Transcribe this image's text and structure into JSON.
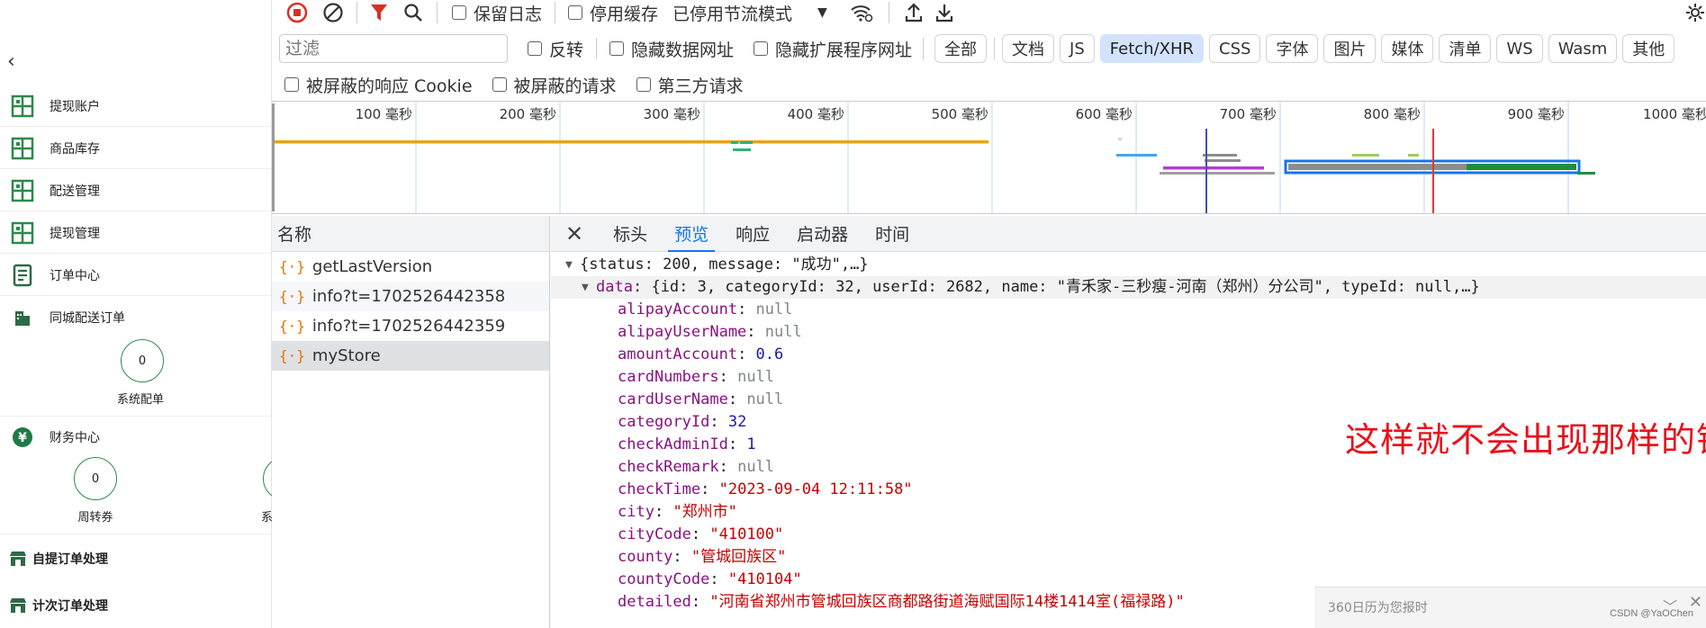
{
  "sidebar": {
    "back_icon": "chevron-left-icon",
    "nav_items": [
      {
        "label": "提现账户",
        "icon": "grid-icon"
      },
      {
        "label": "商品库存",
        "icon": "grid-icon"
      },
      {
        "label": "配送管理",
        "icon": "grid-icon"
      },
      {
        "label": "提现管理",
        "icon": "grid-icon"
      },
      {
        "label": "订单中心",
        "icon": "document-icon"
      },
      {
        "label": "同城配送订单",
        "icon": "building-icon"
      }
    ],
    "dispatch_circle": {
      "value": "0",
      "label": "系统配单"
    },
    "finance": {
      "label": "财务中心",
      "icon": "yen-icon"
    },
    "finance_circles": [
      {
        "value": "0",
        "label": "周转券"
      },
      {
        "value": "",
        "label": "系"
      }
    ],
    "sections": [
      {
        "label": "自提订单处理",
        "icon": "shop-icon"
      },
      {
        "label": "计次订单处理",
        "icon": "shop-icon"
      }
    ]
  },
  "devtools": {
    "toolbar": {
      "preserve_log": "保留日志",
      "disable_cache": "停用缓存",
      "throttling": "已停用节流模式"
    },
    "filter": {
      "placeholder": "过滤",
      "invert": "反转",
      "hide_data_urls": "隐藏数据网址",
      "hide_extension_urls": "隐藏扩展程序网址",
      "types": [
        "全部",
        "文档",
        "JS",
        "Fetch/XHR",
        "CSS",
        "字体",
        "图片",
        "媒体",
        "清单",
        "WS",
        "Wasm",
        "其他"
      ],
      "active_type": "Fetch/XHR",
      "blocked_cookies": "被屏蔽的响应 Cookie",
      "blocked_requests": "被屏蔽的请求",
      "third_party": "第三方请求"
    },
    "timeline": {
      "ticks": [
        "100 毫秒",
        "200 毫秒",
        "300 毫秒",
        "400 毫秒",
        "500 毫秒",
        "600 毫秒",
        "700 毫秒",
        "800 毫秒",
        "900 毫秒",
        "1000 毫秒"
      ]
    },
    "requests": {
      "header": "名称",
      "items": [
        "getLastVersion",
        "info?t=1702526442358",
        "info?t=1702526442359",
        "myStore"
      ],
      "selected": "myStore"
    },
    "preview_tabs": [
      "标头",
      "预览",
      "响应",
      "启动器",
      "时间"
    ],
    "active_tab": "预览",
    "json": {
      "root_summary": "{status: 200, message: \"成功\",…}",
      "data_key": "data",
      "data_summary": "{id: 3, categoryId: 32, userId: 2682, name: \"青禾家-三秒瘦-河南（郑州）分公司\", typeId: null,…}",
      "fields": [
        {
          "key": "alipayAccount",
          "value": "null",
          "type": "null"
        },
        {
          "key": "alipayUserName",
          "value": "null",
          "type": "null"
        },
        {
          "key": "amountAccount",
          "value": "0.6",
          "type": "num"
        },
        {
          "key": "cardNumbers",
          "value": "null",
          "type": "null"
        },
        {
          "key": "cardUserName",
          "value": "null",
          "type": "null"
        },
        {
          "key": "categoryId",
          "value": "32",
          "type": "num"
        },
        {
          "key": "checkAdminId",
          "value": "1",
          "type": "num"
        },
        {
          "key": "checkRemark",
          "value": "null",
          "type": "null"
        },
        {
          "key": "checkTime",
          "value": "\"2023-09-04 12:11:58\"",
          "type": "str"
        },
        {
          "key": "city",
          "value": "\"郑州市\"",
          "type": "str"
        },
        {
          "key": "cityCode",
          "value": "\"410100\"",
          "type": "str"
        },
        {
          "key": "county",
          "value": "\"管城回族区\"",
          "type": "str"
        },
        {
          "key": "countyCode",
          "value": "\"410104\"",
          "type": "str"
        },
        {
          "key": "detailed",
          "value": "\"河南省郑州市管城回族区商都路街道海赋国际14楼1414室(福禄路)\"",
          "type": "str"
        }
      ]
    },
    "annotation": "这样就不会出现那样的错误"
  },
  "toast": {
    "text": "360日历为您报时",
    "watermark": "CSDN @YaOChen"
  }
}
